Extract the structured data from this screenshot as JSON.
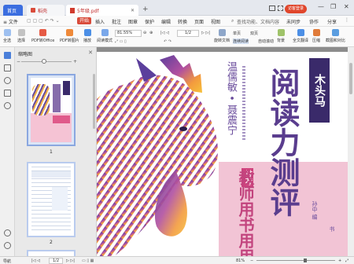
{
  "tabs": {
    "home": "首页",
    "templates": "稻壳",
    "file": "5年级.pdf",
    "add": "+"
  },
  "titlebar": {
    "login": "访客登录",
    "minimize": "—",
    "restore": "❐",
    "close": "✕"
  },
  "menu": {
    "file": "≡ 文件",
    "items": [
      "开始",
      "插入",
      "批注",
      "图章",
      "保护",
      "编辑",
      "转换",
      "页面",
      "视图"
    ],
    "search": "查找功能、文档内容",
    "sync": "未同步",
    "collab": "协作",
    "share": "分享"
  },
  "toolbar": {
    "tools": [
      "全选",
      "选择",
      "PDF转Office",
      "PDF转图片",
      "播放",
      "阅读模式"
    ],
    "zoom_value": "81.55%",
    "page_value": "1/2",
    "rotate": "旋转文档",
    "single": "单页",
    "double": "双页",
    "continuous": "连续阅读",
    "auto_scroll": "自动滚动",
    "background": "背景",
    "translate": "全文翻译",
    "compress": "压缩",
    "screenshot": "截图和对比"
  },
  "sidebar": {
    "title": "缩略图",
    "close": "✕",
    "zoom_out": "−",
    "zoom_in": "+",
    "pages": [
      {
        "number": "1"
      },
      {
        "number": "2"
      }
    ]
  },
  "cover": {
    "publisher": "木头马",
    "title": "阅读力测评",
    "author_line": "温儒敏 • 聂震宁",
    "recommend": "推荐",
    "subtitle": "教师用书用用",
    "editor": "孙中 编",
    "small": "书"
  },
  "status": {
    "nav": "导航",
    "page": "1/2",
    "zoom_value": "81%",
    "zoom_out": "−",
    "zoom_in": "+"
  },
  "colors": {
    "accent": "#3b6ee0",
    "brand": "#d94b3a",
    "cover_pink": "#f2c4d5",
    "cover_purple": "#6a4c9c"
  }
}
